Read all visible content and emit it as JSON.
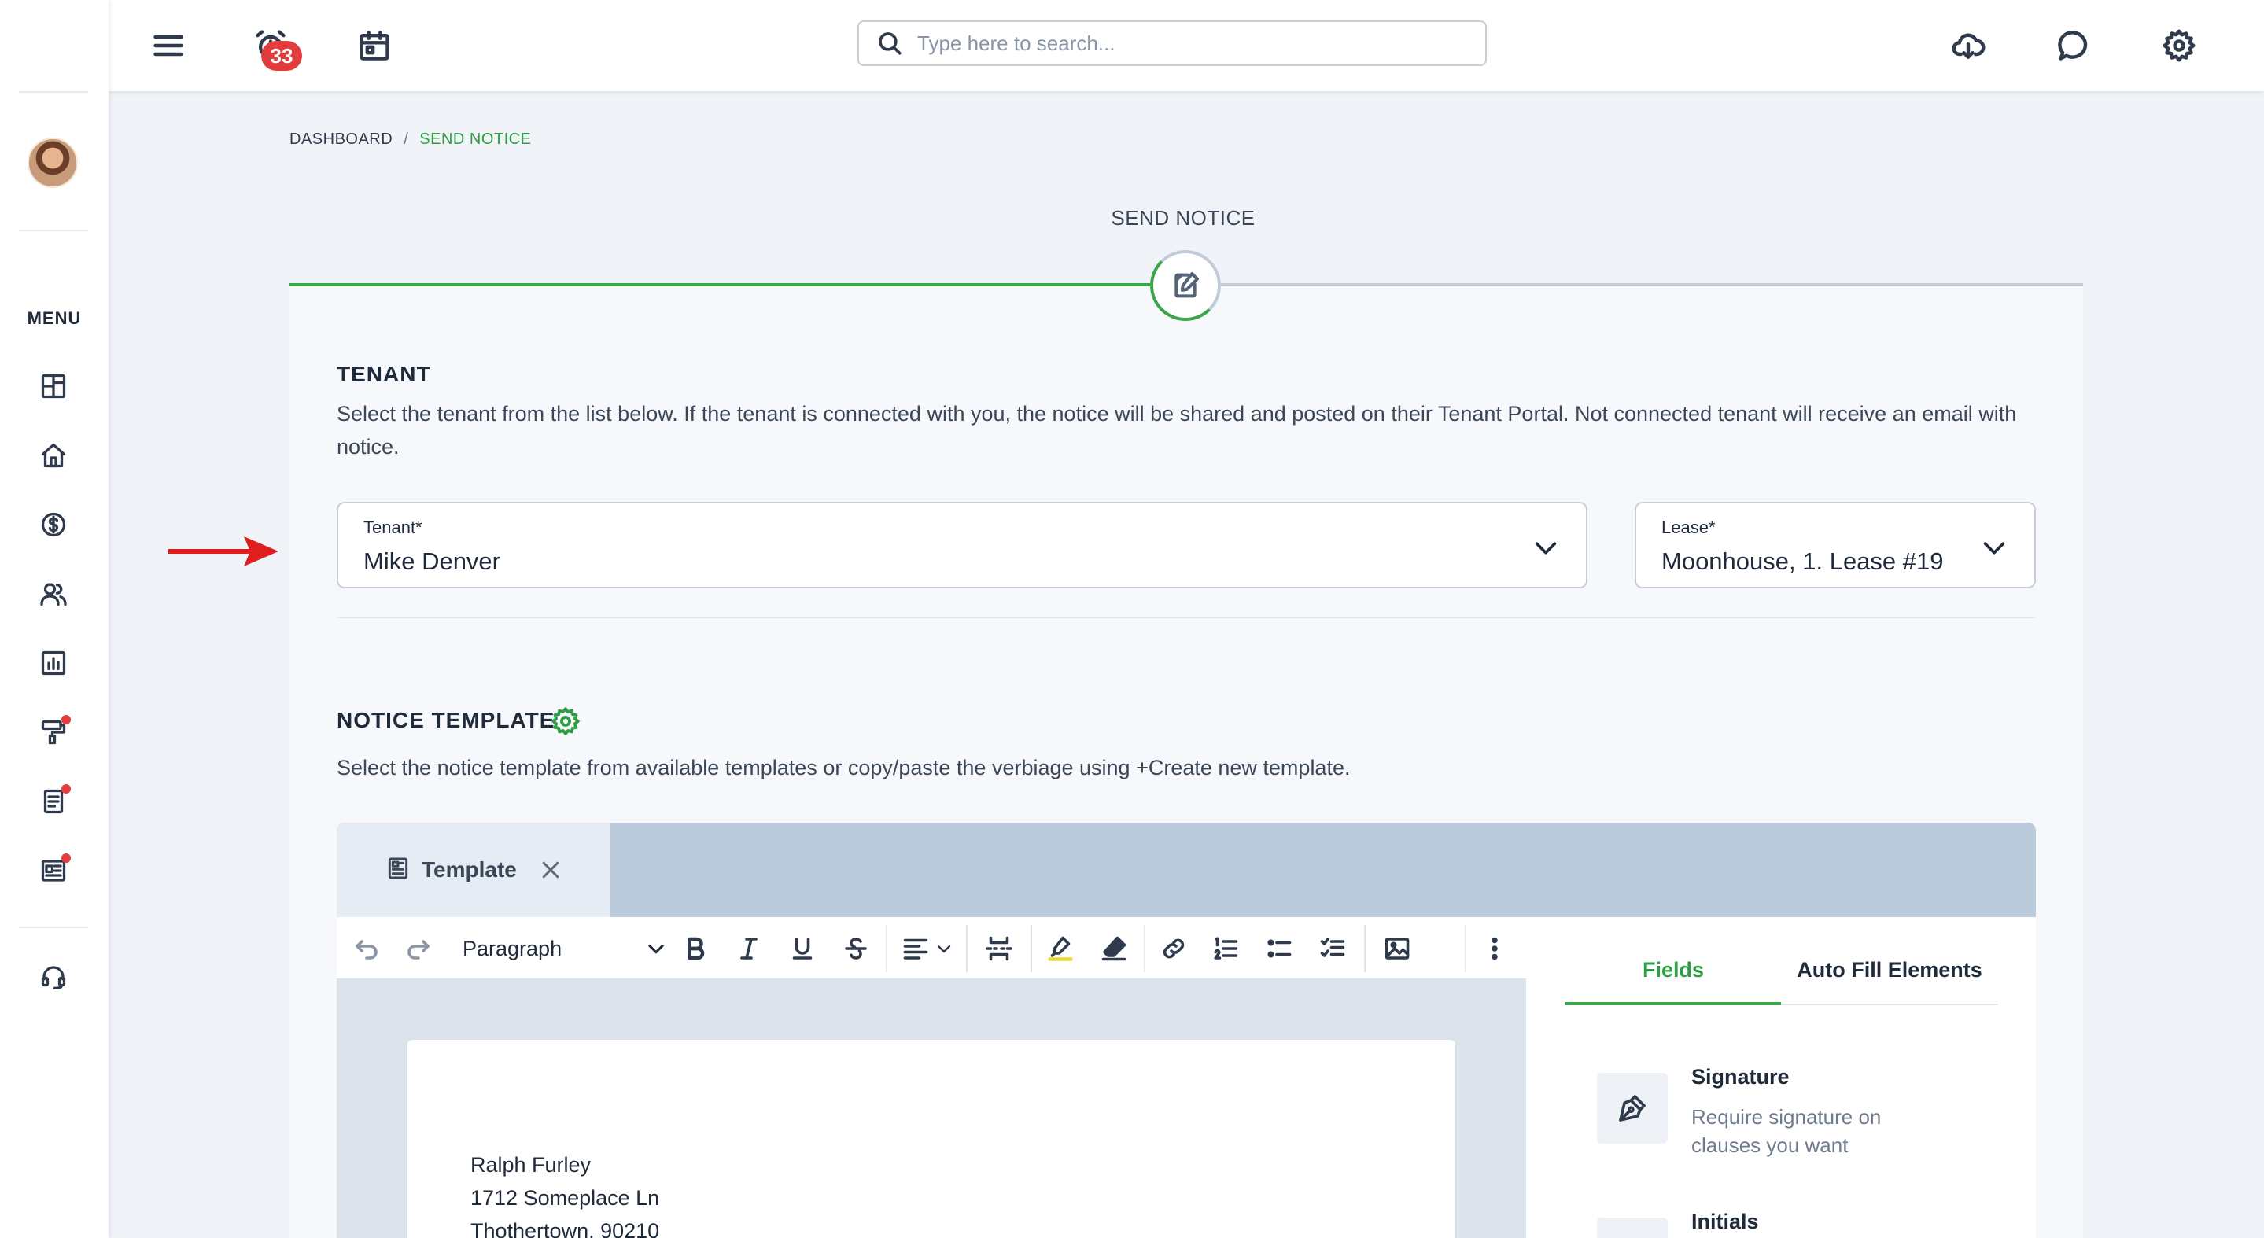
{
  "header": {
    "notifications_count": "33",
    "search_placeholder": "Type here to search..."
  },
  "sidebar": {
    "menu_label": "MENU",
    "items": [
      {
        "icon": "dashboard-icon"
      },
      {
        "icon": "home-icon"
      },
      {
        "icon": "dollar-icon"
      },
      {
        "icon": "people-icon"
      },
      {
        "icon": "reports-icon"
      },
      {
        "icon": "paint-roller-icon",
        "has_alert": true
      },
      {
        "icon": "document-icon",
        "has_alert": true
      },
      {
        "icon": "newspaper-icon",
        "has_alert": true
      },
      {
        "icon": "headset-icon"
      }
    ]
  },
  "breadcrumb": {
    "root": "DASHBOARD",
    "separator": "/",
    "current": "SEND NOTICE"
  },
  "page_title": "SEND NOTICE",
  "tenant_section": {
    "title": "TENANT",
    "description": "Select the tenant from the list below. If the tenant is connected with you, the notice will be shared and posted on their Tenant Portal. Not connected tenant will receive an email with notice.",
    "tenant_field": {
      "label": "Tenant*",
      "value": "Mike Denver"
    },
    "lease_field": {
      "label": "Lease*",
      "value": "Moonhouse, 1. Lease #19"
    }
  },
  "template_section": {
    "title": "NOTICE TEMPLATE",
    "description": "Select the notice template from available templates or copy/paste the verbiage using +Create new template."
  },
  "editor": {
    "tab_label": "Template",
    "paragraph_style": "Paragraph",
    "document_lines": [
      "Ralph Furley",
      "1712 Someplace Ln",
      "Thothertown, 90210"
    ]
  },
  "right_panel": {
    "tabs": [
      "Fields",
      "Auto Fill Elements"
    ],
    "active_tab": "Fields",
    "fields": [
      {
        "name": "Signature",
        "description": "Require signature on clauses you want"
      },
      {
        "name": "Initials",
        "description": ""
      }
    ]
  },
  "colors": {
    "accent_green": "#39a64a",
    "alert_red": "#e23c3c",
    "arrow_red": "#e01e1e"
  }
}
